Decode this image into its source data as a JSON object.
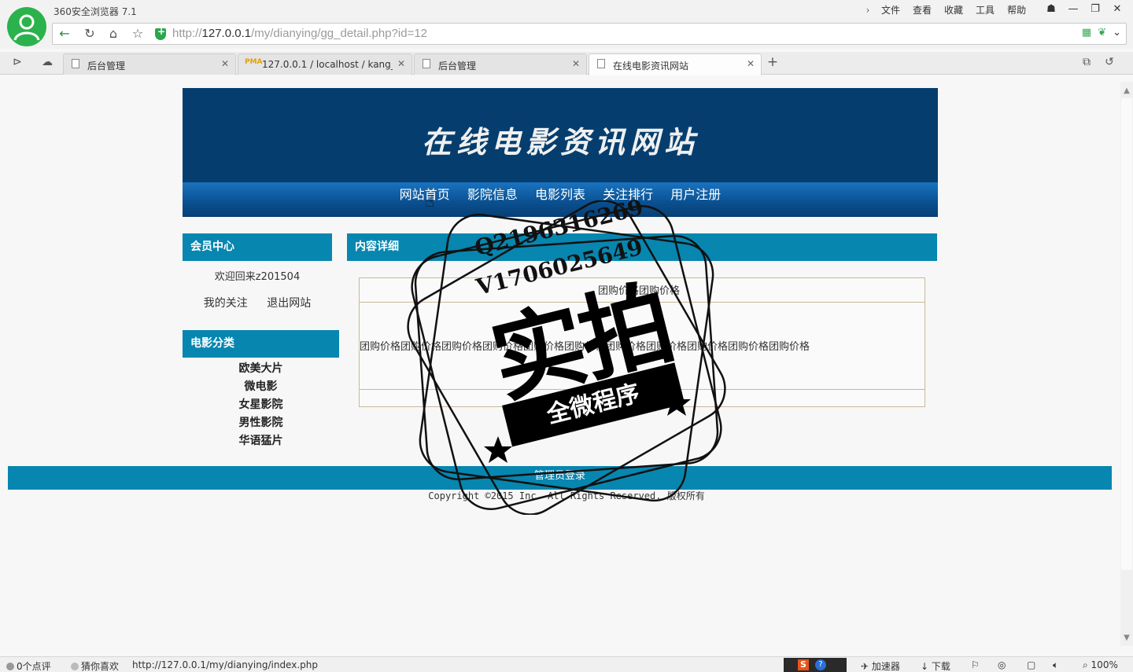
{
  "browser": {
    "app_title": "360安全浏览器 7.1",
    "menu": [
      "文件",
      "查看",
      "收藏",
      "工具",
      "帮助"
    ],
    "url_prefix": "http://",
    "url_host": "127.0.0.1",
    "url_path": "/my/dianying/gg_detail.php?id=12",
    "tabs": [
      {
        "label": "后台管理",
        "active": false
      },
      {
        "label": "127.0.0.1 / localhost / kang_",
        "active": false
      },
      {
        "label": "后台管理",
        "active": false
      },
      {
        "label": "在线电影资讯网站",
        "active": true
      }
    ]
  },
  "site": {
    "title": "在线电影资讯网站",
    "nav": [
      "网站首页",
      "影院信息",
      "电影列表",
      "关注排行",
      "用户注册"
    ]
  },
  "sidebar": {
    "member_title": "会员中心",
    "welcome": "欢迎回来z201504",
    "links": [
      "我的关注",
      "退出网站"
    ],
    "category_title": "电影分类",
    "categories": [
      "欧美大片",
      "微电影",
      "女星影院",
      "男性影院",
      "华语猛片"
    ]
  },
  "content": {
    "panel_title": "内容详细",
    "detail_title": "团购价格团购价格",
    "detail_body": "团购价格团购价格团购价格团购价格团购价格团购价格团购价格团购价格团购价格团购价格团购价格"
  },
  "footer": {
    "admin_login": "管理员登录",
    "copyright": "Copyright ©2015 Inc. All Rights Reserved. 版权所有"
  },
  "watermark": {
    "line1": "Q2196316269",
    "line2": "V1706025649",
    "big": "实拍",
    "ribbon": "全微程序"
  },
  "statusbar": {
    "comments": "0个点评",
    "guess": "猜你喜欢",
    "hover_url": "http://127.0.0.1/my/dianying/index.php",
    "accelerator": "加速器",
    "download": "下载",
    "zoom": "100%"
  },
  "colors": {
    "header_bg": "#053e6e",
    "panel_bg": "#0786b0",
    "nav_bg": "#0a4f8f",
    "avatar_green": "#2bb24c"
  }
}
